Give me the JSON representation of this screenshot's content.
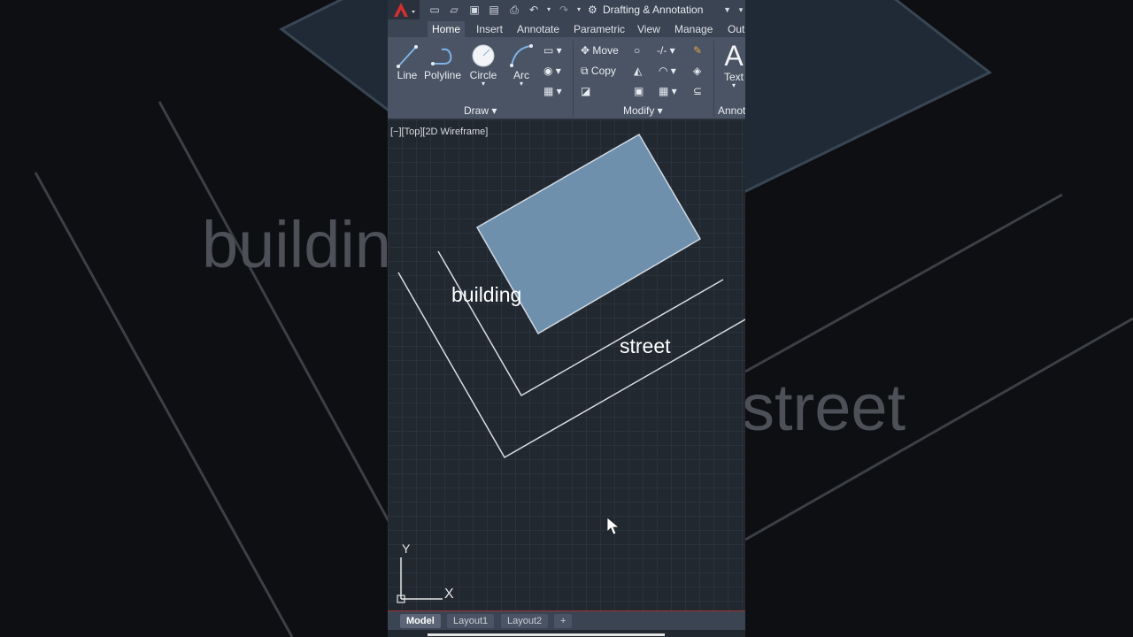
{
  "app": {
    "workspace": "Drafting & Annotation",
    "colors": {
      "accent": "#d32f2f",
      "panel": "#4a5464",
      "canvas": "#212830",
      "fill": "#6f90ad"
    }
  },
  "qat": {
    "icons": [
      "new-icon",
      "open-icon",
      "save-icon",
      "save-as-icon",
      "print-icon",
      "undo-icon",
      "redo-icon"
    ]
  },
  "tabs": [
    "Home",
    "Insert",
    "Annotate",
    "Parametric",
    "View",
    "Manage",
    "Out"
  ],
  "ribbon": {
    "draw": {
      "line": "Line",
      "polyline": "Polyline",
      "circle": "Circle",
      "arc": "Arc",
      "panel": "Draw"
    },
    "modify": {
      "move": "Move",
      "copy": "Copy",
      "panel": "Modify"
    },
    "annotation": {
      "text": "Text",
      "panel": "Annot"
    }
  },
  "viewport": {
    "label": "[−][Top][2D Wireframe]",
    "text_building": "building",
    "text_street": "street",
    "ucs_x": "X",
    "ucs_y": "Y"
  },
  "background": {
    "text_building": "buildin",
    "text_street": "street"
  },
  "layouts": [
    "Model",
    "Layout1",
    "Layout2",
    "+"
  ]
}
